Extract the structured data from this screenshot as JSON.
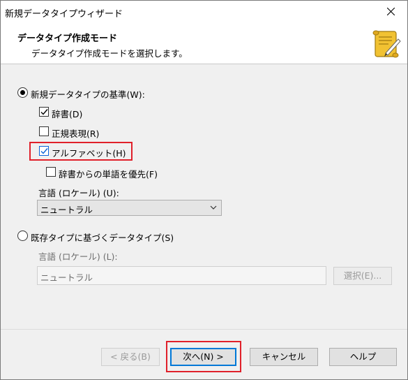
{
  "window": {
    "title": "新規データタイプウィザード"
  },
  "header": {
    "title": "データタイプ作成モード",
    "subtitle": "データタイプ作成モードを選択します。",
    "icon": "scroll-quill-icon"
  },
  "options": {
    "new_type": {
      "label": "新規データタイプの基準(W):",
      "selected": true
    },
    "dictionary": {
      "label": "辞書(D)",
      "checked": true
    },
    "regex": {
      "label": "正規表現(R)",
      "checked": false
    },
    "alphabet": {
      "label": "アルファベット(H)",
      "checked": true
    },
    "prefer_dictionary": {
      "label": "辞書からの単語を優先(F)",
      "checked": false
    },
    "locale_label": "言語 (ロケール) (U):",
    "locale_value": "ニュートラル",
    "existing_type": {
      "label": "既存タイプに基づくデータタイプ(S)",
      "selected": false
    },
    "existing_locale_label": "言語 (ロケール) (L):",
    "existing_locale_value": "ニュートラル",
    "select_button": "選択(E)..."
  },
  "footer": {
    "back": "< 戻る(B)",
    "next": "次へ(N) >",
    "cancel": "キャンセル",
    "help": "ヘルプ"
  },
  "colors": {
    "highlight": "#e0202a",
    "accent": "#0078d7"
  }
}
